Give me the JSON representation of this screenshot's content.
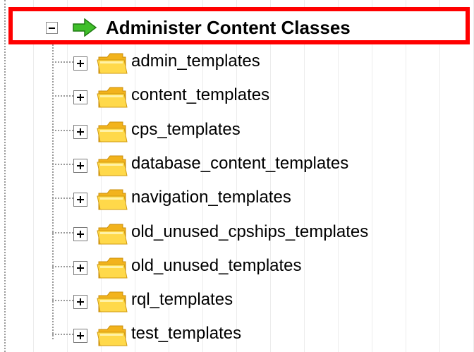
{
  "tree": {
    "top_fragment": "´  ·  ·  ·  ·   ·   ·  ·  ·",
    "root": {
      "label": "Administer Content Classes",
      "expanded": true,
      "icon": "green-arrow-icon"
    },
    "children": [
      {
        "label": "admin_templates",
        "icon": "folder-icon",
        "expanded": false
      },
      {
        "label": "content_templates",
        "icon": "folder-icon",
        "expanded": false
      },
      {
        "label": "cps_templates",
        "icon": "folder-icon",
        "expanded": false
      },
      {
        "label": "database_content_templates",
        "icon": "folder-icon",
        "expanded": false
      },
      {
        "label": "navigation_templates",
        "icon": "folder-icon",
        "expanded": false
      },
      {
        "label": "old_unused_cpships_templates",
        "icon": "folder-icon",
        "expanded": false
      },
      {
        "label": "old_unused_templates",
        "icon": "folder-icon",
        "expanded": false
      },
      {
        "label": "rql_templates",
        "icon": "folder-icon",
        "expanded": false
      },
      {
        "label": "test_templates",
        "icon": "folder-icon",
        "expanded": false
      }
    ]
  },
  "colors": {
    "highlight_border": "#ff0000",
    "arrow": "#33aa22",
    "folder": "#f8c731",
    "tree_lines": "#9a9a9a"
  }
}
